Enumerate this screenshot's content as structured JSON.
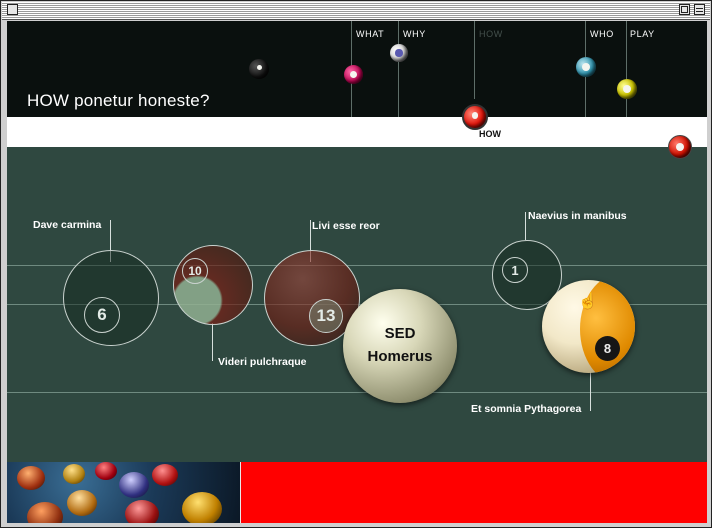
{
  "window": {
    "title": ""
  },
  "header": {
    "page_title": "HOW ponetur honeste?"
  },
  "nav": {
    "items": [
      {
        "label": "WHAT",
        "active": false
      },
      {
        "label": "WHY",
        "active": false
      },
      {
        "label": "HOW",
        "active": true
      },
      {
        "label": "WHO",
        "active": false
      },
      {
        "label": "PLAY",
        "active": false
      }
    ],
    "current_label": "HOW"
  },
  "balls": {
    "dave": {
      "label": "Dave carmina",
      "number": "6"
    },
    "videri": {
      "label": "Videri pulchraque",
      "number": "10"
    },
    "livi": {
      "label": "Livi esse reor",
      "number": "13"
    },
    "sed": {
      "line1": "SED",
      "line2": "Homerus"
    },
    "naevius": {
      "label": "Naevius in manibus",
      "number": "1"
    },
    "somnia": {
      "label": "Et somnia Pythagorea",
      "number": "8"
    }
  },
  "colors": {
    "felt": "#2f4840",
    "red_panel": "#ff0000",
    "header": "#0a100e"
  }
}
